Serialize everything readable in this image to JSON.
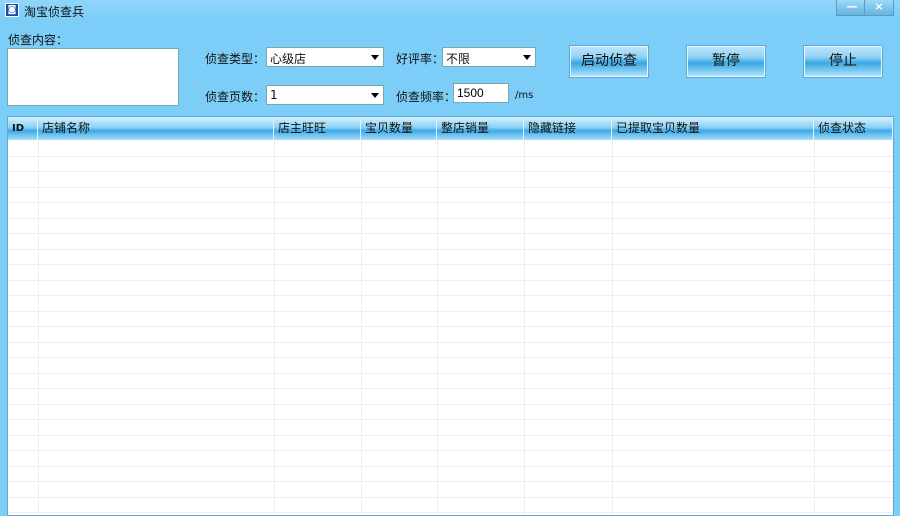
{
  "window": {
    "title": "淘宝侦查兵",
    "minimize": "—",
    "close": "×"
  },
  "form": {
    "content_label": "侦查内容：",
    "content_value": "",
    "type_label": "侦查类型：",
    "type_value": "心级店",
    "rating_label": "好评率：",
    "rating_value": "不限",
    "pages_label": "侦查页数：",
    "pages_value": "1",
    "freq_label": "侦查频率：",
    "freq_value": "1500",
    "freq_unit": "/ms"
  },
  "buttons": {
    "start": "启动侦查",
    "pause": "暂停",
    "stop": "停止"
  },
  "table": {
    "columns": [
      "ID",
      "店铺名称",
      "店主旺旺",
      "宝贝数量",
      "整店销量",
      "隐藏链接",
      "已提取宝贝数量",
      "侦查状态"
    ],
    "rows": []
  }
}
